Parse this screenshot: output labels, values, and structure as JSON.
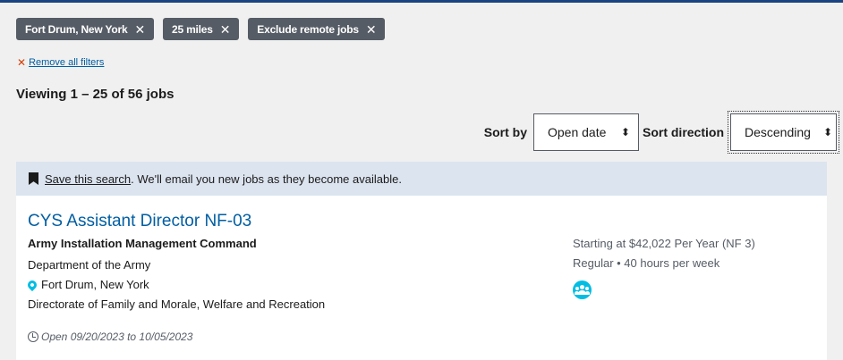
{
  "filters": {
    "chips": [
      {
        "label": "Fort Drum, New York",
        "remove_glyph": "✕"
      },
      {
        "label": "25 miles",
        "remove_glyph": "✕"
      },
      {
        "label": "Exclude remote jobs",
        "remove_glyph": "✕"
      }
    ],
    "remove_all_glyph": "✕",
    "remove_all_label": "Remove all filters"
  },
  "results": {
    "viewing_text": "Viewing 1 – 25 of 56 jobs"
  },
  "sort": {
    "sort_by_label": "Sort by",
    "sort_by_value": "Open date",
    "direction_label": "Sort direction",
    "direction_value": "Descending",
    "caret_glyph": "⬍"
  },
  "save_search": {
    "icon": "bookmark-icon",
    "link_text": "Save this search",
    "rest_text": ". We'll email you new jobs as they become available."
  },
  "job": {
    "title": "CYS Assistant Director NF-03",
    "agency": "Army Installation Management Command",
    "department": "Department of the Army",
    "location": "Fort Drum, New York",
    "directorate": "Directorate of Family and Morale, Welfare and Recreation",
    "open_dates": "Open 09/20/2023 to 10/05/2023",
    "salary": "Starting at $42,022 Per Year (NF 3)",
    "schedule": "Regular • 40 hours per week",
    "hiring_path_icon": "group-icon"
  },
  "colors": {
    "accent": "#005ea2",
    "chip_bg": "#565c65",
    "info_bar": "#dce4ef",
    "icon_cyan": "#00bde3"
  }
}
